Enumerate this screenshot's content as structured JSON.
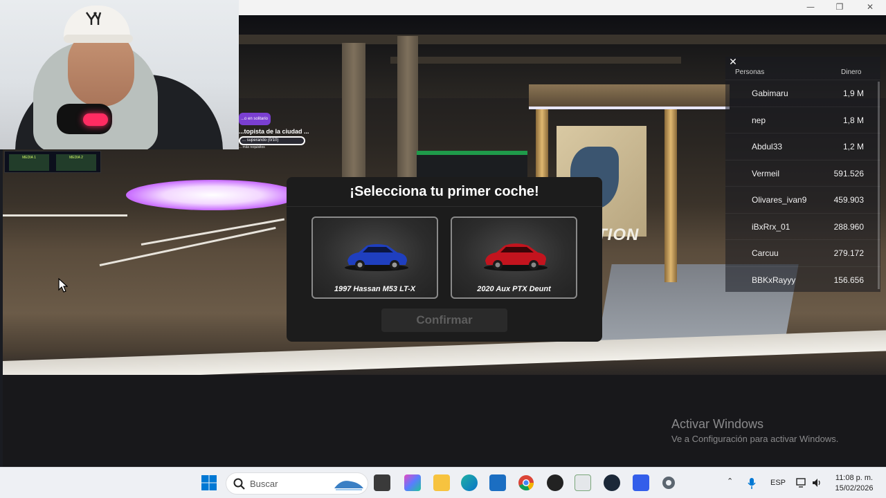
{
  "window": {
    "minimize_glyph": "—",
    "maximize_glyph": "❐",
    "close_glyph": "✕"
  },
  "hud": {
    "mode_pill": "...o en solitario",
    "quest_title": "...topista de la ciudad ...",
    "quest_progress": "... superando (0/10)",
    "quest_sub": "... más requisitos",
    "board_cells": [
      "MEDIA 1",
      "MEDIA 2"
    ]
  },
  "leaderboard": {
    "close_glyph": "✕",
    "header_name": "Personas",
    "header_money": "Dinero",
    "rows": [
      {
        "name": "Gabimaru",
        "money": "1,9 M"
      },
      {
        "name": "nep",
        "money": "1,8 M"
      },
      {
        "name": "Abdul33",
        "money": "1,2 M"
      },
      {
        "name": "Vermeil",
        "money": "591.526"
      },
      {
        "name": "Olivares_ivan9",
        "money": "459.903"
      },
      {
        "name": "iBxRrx_01",
        "money": "288.960"
      },
      {
        "name": "Carcuu",
        "money": "279.172"
      },
      {
        "name": "BBKxRayyy",
        "money": "156.656"
      }
    ]
  },
  "scene": {
    "station_sign": "TION"
  },
  "modal": {
    "title": "¡Selecciona tu primer coche!",
    "cars": [
      {
        "label": "1997 Hassan M53 LT-X",
        "color": "#1f3fbf"
      },
      {
        "label": "2020 Aux PTX Deunt",
        "color": "#c3141e"
      }
    ],
    "confirm_label": "Confirmar"
  },
  "watermark": {
    "title": "Activar Windows",
    "subtitle": "Ve a Configuración para activar Windows."
  },
  "taskbar": {
    "search_placeholder": "Buscar",
    "language": "ESP",
    "time": "11:08 p. m.",
    "date": "15/02/2026"
  },
  "colors": {
    "modal_bg": "#1c1c1c",
    "confirm_disabled_text": "#5e5e5e",
    "accent_purple": "#7a3fd1",
    "windows_blue": "#0078d4"
  }
}
